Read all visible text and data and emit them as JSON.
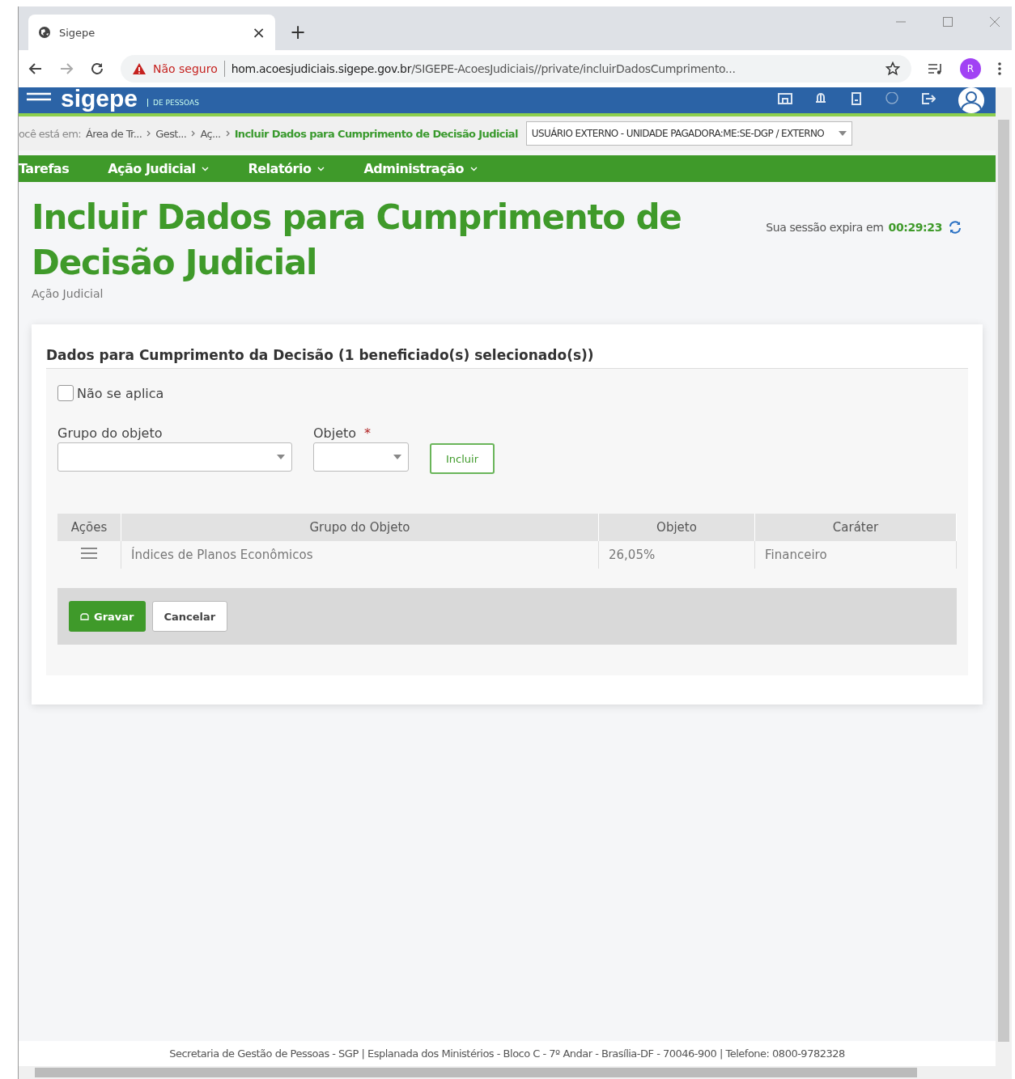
{
  "browser": {
    "tab_title": "Sigepe",
    "tab_close": "×",
    "new_tab": "+",
    "security": "Não seguro",
    "url_host": "hom.acoesjudiciais.sigepe.gov.br",
    "url_path": "/SIGEPE-AcoesJudiciais//private/incluirDadosCumprimento...",
    "avatar": "R"
  },
  "header": {
    "logo": "sigepe",
    "logo_sub": "DE PESSOAS"
  },
  "breadcrumb": {
    "prefix": "ocê está em:",
    "items": [
      {
        "label": "Área de Tr...",
        "current": false
      },
      {
        "label": "Gest...",
        "current": false
      },
      {
        "label": "Aç...",
        "current": false
      },
      {
        "label": "Incluir Dados para Cumprimento de Decisão Judicial",
        "current": true
      }
    ],
    "profile": "USUÁRIO EXTERNO - UNIDADE PAGADORA:ME:SE-DGP / EXTERNO"
  },
  "nav": [
    {
      "label": "Tarefas",
      "dropdown": false
    },
    {
      "label": "Ação Judicial",
      "dropdown": true
    },
    {
      "label": "Relatório",
      "dropdown": true
    },
    {
      "label": "Administração",
      "dropdown": true
    }
  ],
  "page": {
    "title": "Incluir Dados para Cumprimento de Decisão Judicial",
    "subtitle": "Ação Judicial",
    "session_label": "Sua sessão expira em",
    "session_time": "00:29:23"
  },
  "panel": {
    "heading": "Dados para Cumprimento da Decisão (1 beneficiado(s) selecionado(s))",
    "checkbox": {
      "label": "Não se aplica",
      "checked": false
    },
    "fields": [
      {
        "label": "Grupo do objeto",
        "kind": "wide"
      },
      {
        "label": "Objeto",
        "kind": "narrow",
        "marker": "*"
      }
    ],
    "include_button": "Incluir",
    "table": {
      "columns": [
        "Ações",
        "Grupo do Objeto",
        "Objeto",
        "Caráter"
      ],
      "rows": [
        {
          "cells": [
            "",
            "Índices de Planos Econômicos",
            "26,05%",
            "Financeiro"
          ]
        }
      ]
    },
    "buttons": [
      {
        "label": "Gravar",
        "kind": "primary"
      },
      {
        "label": "Cancelar",
        "kind": "secondary"
      }
    ]
  },
  "footer": "Secretaria de Gestão de Pessoas - SGP | Esplanada dos Ministérios - Bloco C - 7º Andar - Brasília-DF - 70046-900 | Telefone: 0800-9782328"
}
